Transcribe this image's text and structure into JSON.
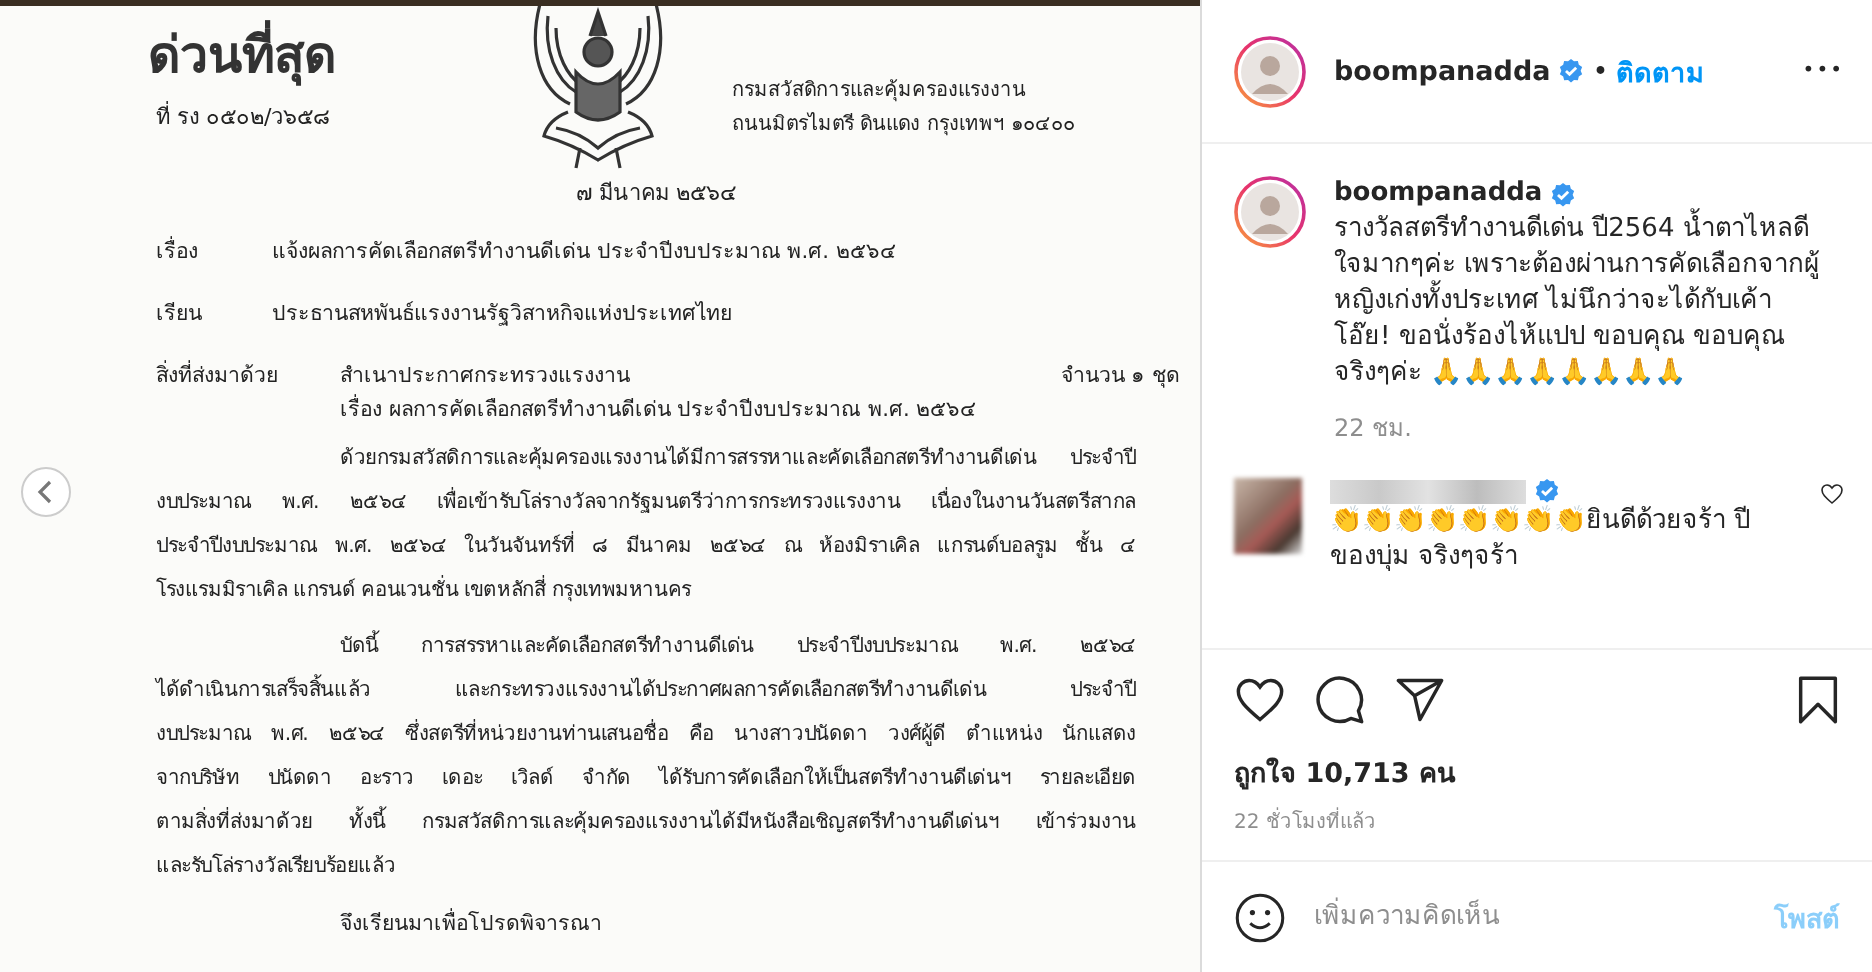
{
  "post_image": {
    "document": {
      "urgency": "ด่วนที่สุด",
      "reference": "ที่ รง ๐๕๐๒/ว๖๕๘",
      "sender_address": [
        "กรมสวัสดิการและคุ้มครองแรงงาน",
        "ถนนมิตรไมตรี ดินแดง กรุงเทพฯ ๑๐๔๐๐"
      ],
      "date": "๗ มีนาคม ๒๕๖๔",
      "subject": {
        "label": "เรื่อง",
        "text": "แจ้งผลการคัดเลือกสตรีทำงานดีเด่น ประจำปีงบประมาณ พ.ศ. ๒๕๖๔"
      },
      "recipient": {
        "label": "เรียน",
        "text": "ประธานสหพันธ์แรงงานรัฐวิสาหกิจแห่งประเทศไทย"
      },
      "enclosure": {
        "label": "สิ่งที่ส่งมาด้วย",
        "item": "สำเนาประกาศกระทรวงแรงงาน",
        "quantity": "จำนวน ๑ ชุด",
        "item_subject": "เรื่อง ผลการคัดเลือกสตรีทำงานดีเด่น ประจำปีงบประมาณ พ.ศ. ๒๕๖๔"
      },
      "paragraphs": [
        {
          "lines": [
            "ด้วยกรมสวัสดิการและคุ้มครองแรงงานได้มีการสรรหาและคัดเลือกสตรีทำงานดีเด่น ประจำปี",
            "งบประมาณ พ.ศ. ๒๕๖๔ เพื่อเข้ารับโล่รางวัลจากรัฐมนตรีว่าการกระทรวงแรงงาน เนื่องในงานวันสตรีสากล",
            "ประจำปีงบประมาณ พ.ศ. ๒๕๖๔ ในวันจันทร์ที่ ๘ มีนาคม ๒๕๖๔ ณ ห้องมิราเคิล แกรนด์บอลรูม ชั้น ๔",
            "โรงแรมมิราเคิล แกรนด์ คอนเวนชั่น เขตหลักสี่ กรุงเทพมหานคร"
          ]
        },
        {
          "lines": [
            "บัดนี้ การสรรหาและคัดเลือกสตรีทำงานดีเด่น ประจำปีงบประมาณ พ.ศ. ๒๕๖๔",
            "ได้ดำเนินการเสร็จสิ้นแล้ว และกระทรวงแรงงานได้ประกาศผลการคัดเลือกสตรีทำงานดีเด่น ประจำปี",
            "งบประมาณ พ.ศ. ๒๕๖๔ ซึ่งสตรีที่หน่วยงานท่านเสนอชื่อ คือ นางสาวปนัดดา วงศ์ผู้ดี ตำแหน่ง นักแสดง",
            "จากบริษัท ปนัดดา อะราว เดอะ เวิลด์ จำกัด ได้รับการคัดเลือกให้เป็นสตรีทำงานดีเด่นฯ รายละเอียด",
            "ตามสิ่งที่ส่งมาด้วย ทั้งนี้ กรมสวัสดิการและคุ้มครองแรงงานได้มีหนังสือเชิญสตรีทำงานดีเด่นฯ เข้าร่วมงาน",
            "และรับโล่รางวัลเรียบร้อยแล้ว"
          ]
        }
      ],
      "closing": "จึงเรียนมาเพื่อโปรดพิจารณา"
    }
  },
  "header": {
    "username": "boompanadda",
    "verified": true,
    "separator": "•",
    "follow": "ติดตาม",
    "more": "•••"
  },
  "caption": {
    "username": "boompanadda",
    "verified": true,
    "text": "รางวัลสตรีทำงานดีเด่น ปี2564 น้ำตาไหลดีใจมากๆค่ะ เพราะต้องผ่านการคัดเลือกจากผู้หญิงเก่งทั้งประเทศ ไม่นึกว่าจะได้กับเค้า โอ๊ย! ขอนั่งร้องไห้แปป ขอบคุณ ขอบคุณจริงๆค่ะ 🙏🙏🙏🙏🙏🙏🙏🙏",
    "time": "22 ชม."
  },
  "comments": [
    {
      "verified": true,
      "text": "👏👏👏👏👏👏👏👏ยินดีด้วยจร้า ปีของบุ่ม จริงๆจร้า",
      "liked": false
    }
  ],
  "actions": {
    "liked": false,
    "saved": false
  },
  "likes": "ถูกใจ 10,713 คน",
  "posted": "22 ชั่วโมงที่แล้ว",
  "comment_box": {
    "placeholder": "เพิ่มความคิดเห็น",
    "post_button": "โพสต์"
  }
}
